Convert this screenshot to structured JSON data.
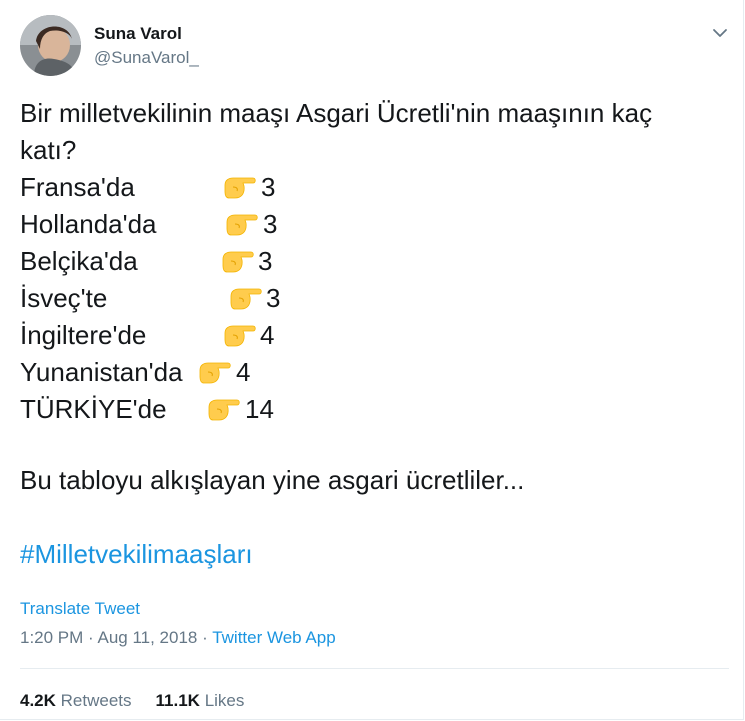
{
  "author": {
    "name": "Suna Varol",
    "handle": "@SunaVarol_"
  },
  "tweet": {
    "question_line1": "Bir milletvekilinin maaşı Asgari Ücretli'nin maaşının kaç",
    "question_line2": "katı?",
    "rows": [
      {
        "country": "Fransa'da",
        "value": "3"
      },
      {
        "country": "Hollanda'da",
        "value": "3"
      },
      {
        "country": "Belçika'da",
        "value": "3"
      },
      {
        "country": "İsveç'te",
        "value": "3"
      },
      {
        "country": "İngiltere'de",
        "value": "4"
      },
      {
        "country": "Yunanistan'da",
        "value": "4"
      },
      {
        "country": "TÜRKİYE'de",
        "value": "14"
      }
    ],
    "closing": "Bu tabloyu alkışlayan yine asgari ücretliler...",
    "hashtag": "#Milletvekilimaaşları"
  },
  "translate_label": "Translate Tweet",
  "meta": {
    "time": "1:20 PM",
    "separator1": " · ",
    "date": "Aug 11, 2018",
    "separator2": " · ",
    "source": "Twitter Web App"
  },
  "stats": {
    "retweets_count": "4.2K",
    "retweets_label": "Retweets",
    "likes_count": "11.1K",
    "likes_label": "Likes"
  },
  "icons": {
    "pointer": "backhand-index-pointing-right-emoji",
    "caret": "chevron-down-icon"
  },
  "colors": {
    "link": "#1b95e0",
    "secondary_text": "#657786",
    "primary_text": "#14171a",
    "emoji_yellow": "#ffcc4d"
  }
}
